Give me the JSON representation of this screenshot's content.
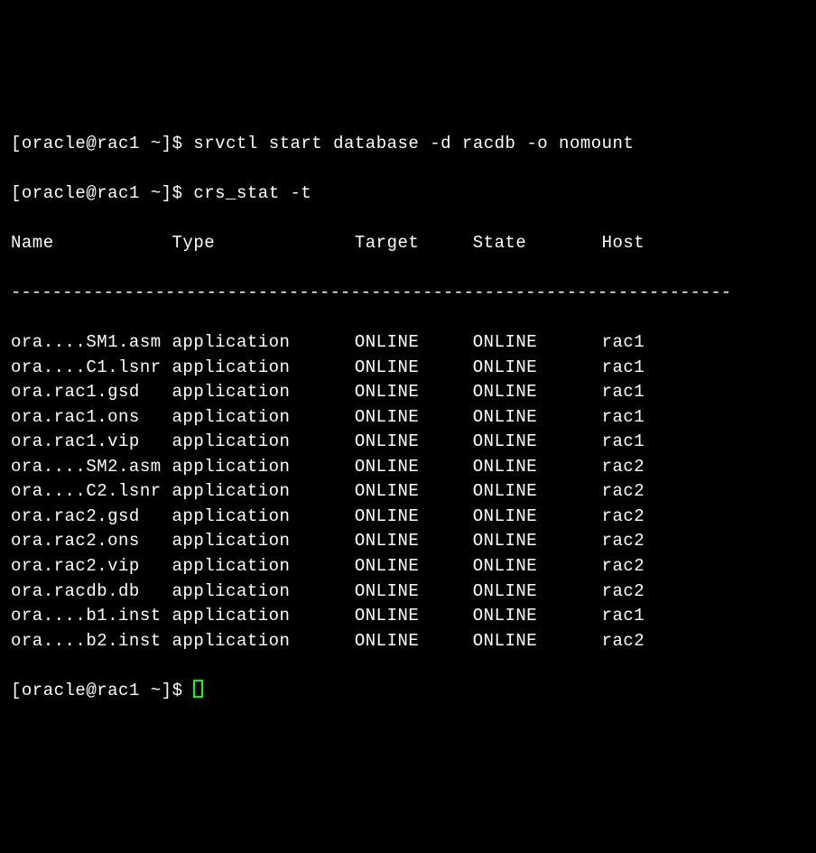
{
  "prompt": {
    "user": "oracle",
    "host": "rac1",
    "path": "~",
    "symbol": "$"
  },
  "commands": {
    "line1": "srvctl start database -d racdb -o nomount",
    "line2": "crs_stat -t"
  },
  "headers": {
    "name": "Name",
    "type": "Type",
    "target": "Target",
    "state": "State",
    "host": "Host"
  },
  "divider": "----------------------------------------------------------------------",
  "rows": [
    {
      "name": "ora....SM1.asm",
      "type": "application",
      "target": "ONLINE",
      "state": "ONLINE",
      "host": "rac1"
    },
    {
      "name": "ora....C1.lsnr",
      "type": "application",
      "target": "ONLINE",
      "state": "ONLINE",
      "host": "rac1"
    },
    {
      "name": "ora.rac1.gsd",
      "type": "application",
      "target": "ONLINE",
      "state": "ONLINE",
      "host": "rac1"
    },
    {
      "name": "ora.rac1.ons",
      "type": "application",
      "target": "ONLINE",
      "state": "ONLINE",
      "host": "rac1"
    },
    {
      "name": "ora.rac1.vip",
      "type": "application",
      "target": "ONLINE",
      "state": "ONLINE",
      "host": "rac1"
    },
    {
      "name": "ora....SM2.asm",
      "type": "application",
      "target": "ONLINE",
      "state": "ONLINE",
      "host": "rac2"
    },
    {
      "name": "ora....C2.lsnr",
      "type": "application",
      "target": "ONLINE",
      "state": "ONLINE",
      "host": "rac2"
    },
    {
      "name": "ora.rac2.gsd",
      "type": "application",
      "target": "ONLINE",
      "state": "ONLINE",
      "host": "rac2"
    },
    {
      "name": "ora.rac2.ons",
      "type": "application",
      "target": "ONLINE",
      "state": "ONLINE",
      "host": "rac2"
    },
    {
      "name": "ora.rac2.vip",
      "type": "application",
      "target": "ONLINE",
      "state": "ONLINE",
      "host": "rac2"
    },
    {
      "name": "ora.racdb.db",
      "type": "application",
      "target": "ONLINE",
      "state": "ONLINE",
      "host": "rac2"
    },
    {
      "name": "ora....b1.inst",
      "type": "application",
      "target": "ONLINE",
      "state": "ONLINE",
      "host": "rac1"
    },
    {
      "name": "ora....b2.inst",
      "type": "application",
      "target": "ONLINE",
      "state": "ONLINE",
      "host": "rac2"
    }
  ],
  "columns": {
    "name_w": 15,
    "type_w": 17,
    "target_w": 11,
    "state_w": 12
  }
}
